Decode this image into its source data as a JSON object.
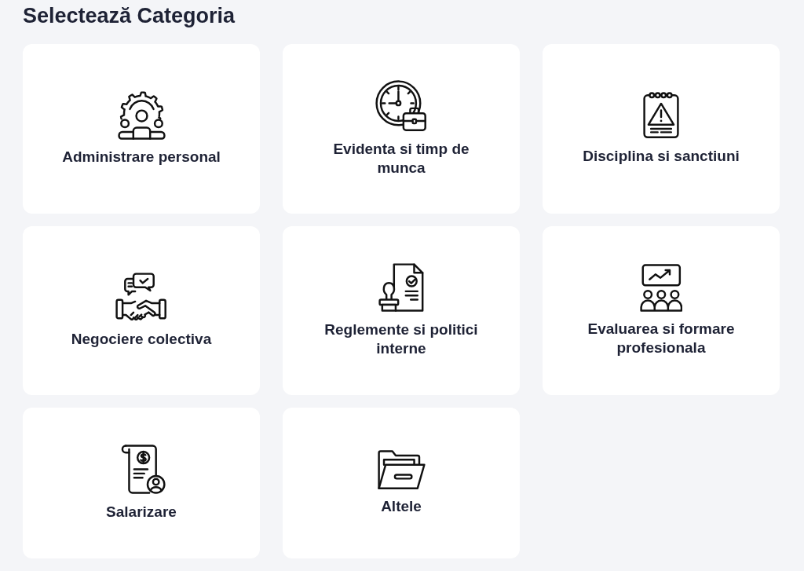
{
  "title": "Selectează Categoria",
  "categories": [
    {
      "label": "Administrare personal"
    },
    {
      "label": "Evidenta si timp de munca"
    },
    {
      "label": "Disciplina si sanctiuni"
    },
    {
      "label": "Negociere colectiva"
    },
    {
      "label": "Reglemente si politici interne"
    },
    {
      "label": "Evaluarea si formare profesionala"
    },
    {
      "label": "Salarizare"
    },
    {
      "label": "Altele"
    }
  ]
}
